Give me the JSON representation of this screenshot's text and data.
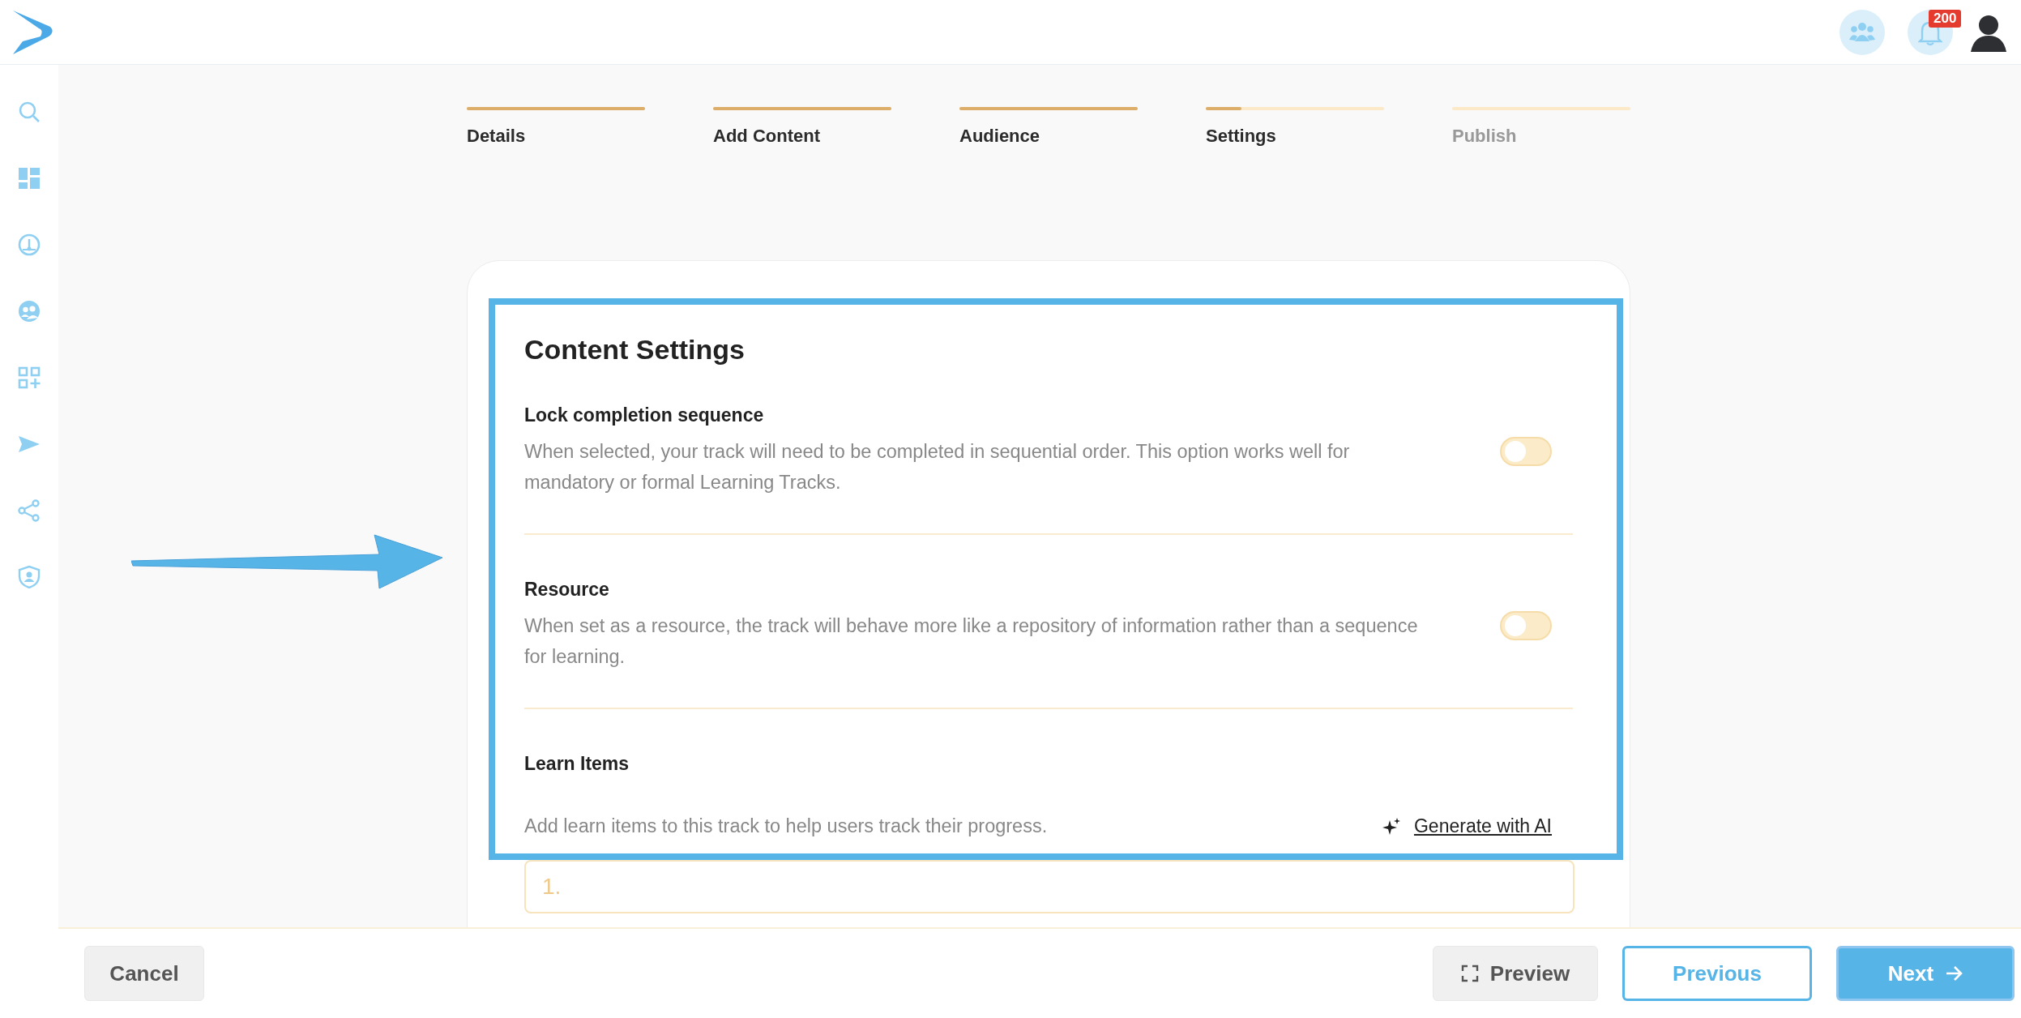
{
  "header": {
    "notifications_badge": "200"
  },
  "stepper": [
    {
      "label": "Details",
      "level": 1
    },
    {
      "label": "Add Content",
      "level": 1
    },
    {
      "label": "Audience",
      "level": 1
    },
    {
      "label": "Settings",
      "level": 0.2
    },
    {
      "label": "Publish",
      "level": 0
    }
  ],
  "content_settings": {
    "title": "Content Settings",
    "options": [
      {
        "label": "Lock completion sequence",
        "description": "When selected, your track will need to be completed in sequential order. This option works well for mandatory or formal Learning Tracks.",
        "on": false
      },
      {
        "label": "Resource",
        "description": "When set as a resource, the track will behave more like a repository of information rather than a sequence for learning.",
        "on": false
      }
    ],
    "learn_items": {
      "label": "Learn Items",
      "description": "Add learn items to this track to help users track their progress.",
      "generate_link": "Generate with AI",
      "input_placeholder": "1."
    }
  },
  "footer": {
    "cancel": "Cancel",
    "preview": "Preview",
    "previous": "Previous",
    "next": "Next"
  }
}
